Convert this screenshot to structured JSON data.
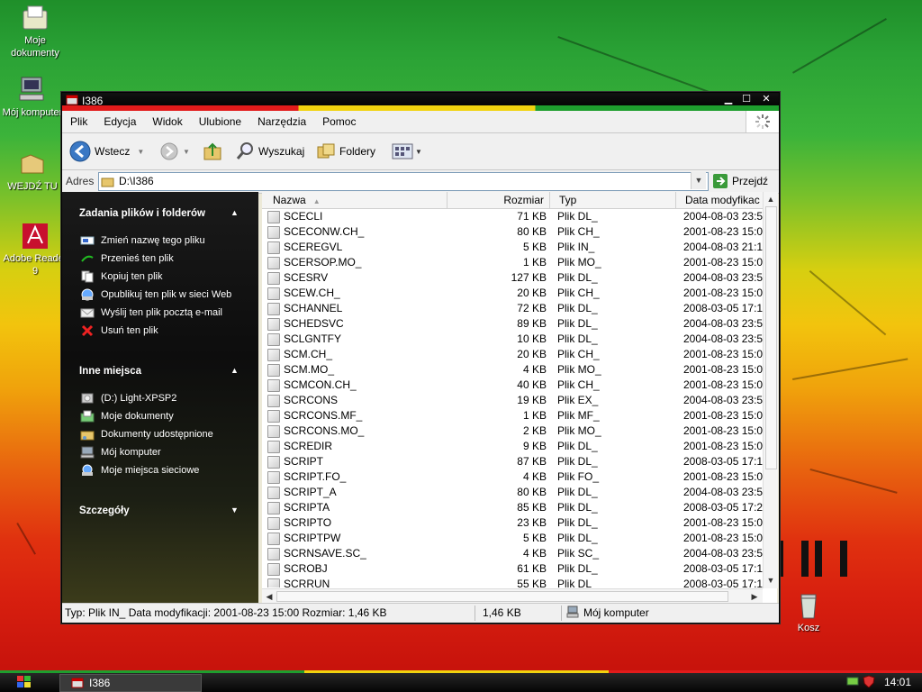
{
  "desktop": {
    "icons": [
      {
        "label": "Moje dokumenty"
      },
      {
        "label": "Mój komputer"
      },
      {
        "label": "WEJDŹ TU"
      },
      {
        "label": "Adobe Reader 9"
      },
      {
        "label": "Kosz"
      }
    ]
  },
  "window": {
    "title": "I386",
    "menu": [
      "Plik",
      "Edycja",
      "Widok",
      "Ulubione",
      "Narzędzia",
      "Pomoc"
    ],
    "toolbar": {
      "back_label": "Wstecz",
      "search_label": "Wyszukaj",
      "folders_label": "Foldery"
    },
    "address": {
      "label": "Adres",
      "value": "D:\\I386",
      "go_label": "Przejdź"
    },
    "leftpane": {
      "tasks_title": "Zadania plików i folderów",
      "tasks": [
        "Zmień nazwę tego pliku",
        "Przenieś ten plik",
        "Kopiuj ten plik",
        "Opublikuj ten plik w sieci Web",
        "Wyślij ten plik pocztą e-mail",
        "Usuń ten plik"
      ],
      "places_title": "Inne miejsca",
      "places": [
        "(D:) Light-XPSP2",
        "Moje dokumenty",
        "Dokumenty udostępnione",
        "Mój komputer",
        "Moje miejsca sieciowe"
      ],
      "details_title": "Szczegóły"
    },
    "columns": {
      "name": "Nazwa",
      "size": "Rozmiar",
      "type": "Typ",
      "date": "Data modyfikac"
    },
    "files": [
      {
        "name": "SCECLI",
        "size": "71 KB",
        "type": "Plik DL_",
        "date": "2004-08-03 23:5"
      },
      {
        "name": "SCECONW.CH_",
        "size": "80 KB",
        "type": "Plik CH_",
        "date": "2001-08-23 15:0"
      },
      {
        "name": "SCEREGVL",
        "size": "5 KB",
        "type": "Plik IN_",
        "date": "2004-08-03 21:1"
      },
      {
        "name": "SCERSOP.MO_",
        "size": "1 KB",
        "type": "Plik MO_",
        "date": "2001-08-23 15:0"
      },
      {
        "name": "SCESRV",
        "size": "127 KB",
        "type": "Plik DL_",
        "date": "2004-08-03 23:5"
      },
      {
        "name": "SCEW.CH_",
        "size": "20 KB",
        "type": "Plik CH_",
        "date": "2001-08-23 15:0"
      },
      {
        "name": "SCHANNEL",
        "size": "72 KB",
        "type": "Plik DL_",
        "date": "2008-03-05 17:1"
      },
      {
        "name": "SCHEDSVC",
        "size": "89 KB",
        "type": "Plik DL_",
        "date": "2004-08-03 23:5"
      },
      {
        "name": "SCLGNTFY",
        "size": "10 KB",
        "type": "Plik DL_",
        "date": "2004-08-03 23:5"
      },
      {
        "name": "SCM.CH_",
        "size": "20 KB",
        "type": "Plik CH_",
        "date": "2001-08-23 15:0"
      },
      {
        "name": "SCM.MO_",
        "size": "4 KB",
        "type": "Plik MO_",
        "date": "2001-08-23 15:0"
      },
      {
        "name": "SCMCON.CH_",
        "size": "40 KB",
        "type": "Plik CH_",
        "date": "2001-08-23 15:0"
      },
      {
        "name": "SCRCONS",
        "size": "19 KB",
        "type": "Plik EX_",
        "date": "2004-08-03 23:5"
      },
      {
        "name": "SCRCONS.MF_",
        "size": "1 KB",
        "type": "Plik MF_",
        "date": "2001-08-23 15:0"
      },
      {
        "name": "SCRCONS.MO_",
        "size": "2 KB",
        "type": "Plik MO_",
        "date": "2001-08-23 15:0"
      },
      {
        "name": "SCREDIR",
        "size": "9 KB",
        "type": "Plik DL_",
        "date": "2001-08-23 15:0"
      },
      {
        "name": "SCRIPT",
        "size": "87 KB",
        "type": "Plik DL_",
        "date": "2008-03-05 17:1"
      },
      {
        "name": "SCRIPT.FO_",
        "size": "4 KB",
        "type": "Plik FO_",
        "date": "2001-08-23 15:0"
      },
      {
        "name": "SCRIPT_A",
        "size": "80 KB",
        "type": "Plik DL_",
        "date": "2004-08-03 23:5"
      },
      {
        "name": "SCRIPTA",
        "size": "85 KB",
        "type": "Plik DL_",
        "date": "2008-03-05 17:2"
      },
      {
        "name": "SCRIPTO",
        "size": "23 KB",
        "type": "Plik DL_",
        "date": "2001-08-23 15:0"
      },
      {
        "name": "SCRIPTPW",
        "size": "5 KB",
        "type": "Plik DL_",
        "date": "2001-08-23 15:0"
      },
      {
        "name": "SCRNSAVE.SC_",
        "size": "4 KB",
        "type": "Plik SC_",
        "date": "2004-08-03 23:5"
      },
      {
        "name": "SCROBJ",
        "size": "61 KB",
        "type": "Plik DL_",
        "date": "2008-03-05 17:1"
      },
      {
        "name": "SCRRUN",
        "size": "55 KB",
        "type": "Plik DL_",
        "date": "2008-03-05 17:1"
      }
    ],
    "status": {
      "info": "Typ: Plik IN_ Data modyfikacji: 2001-08-23 15:00 Rozmiar: 1,46 KB",
      "size": "1,46 KB",
      "zone": "Mój komputer"
    }
  },
  "taskbar": {
    "item": "I386",
    "clock": "14:01"
  }
}
